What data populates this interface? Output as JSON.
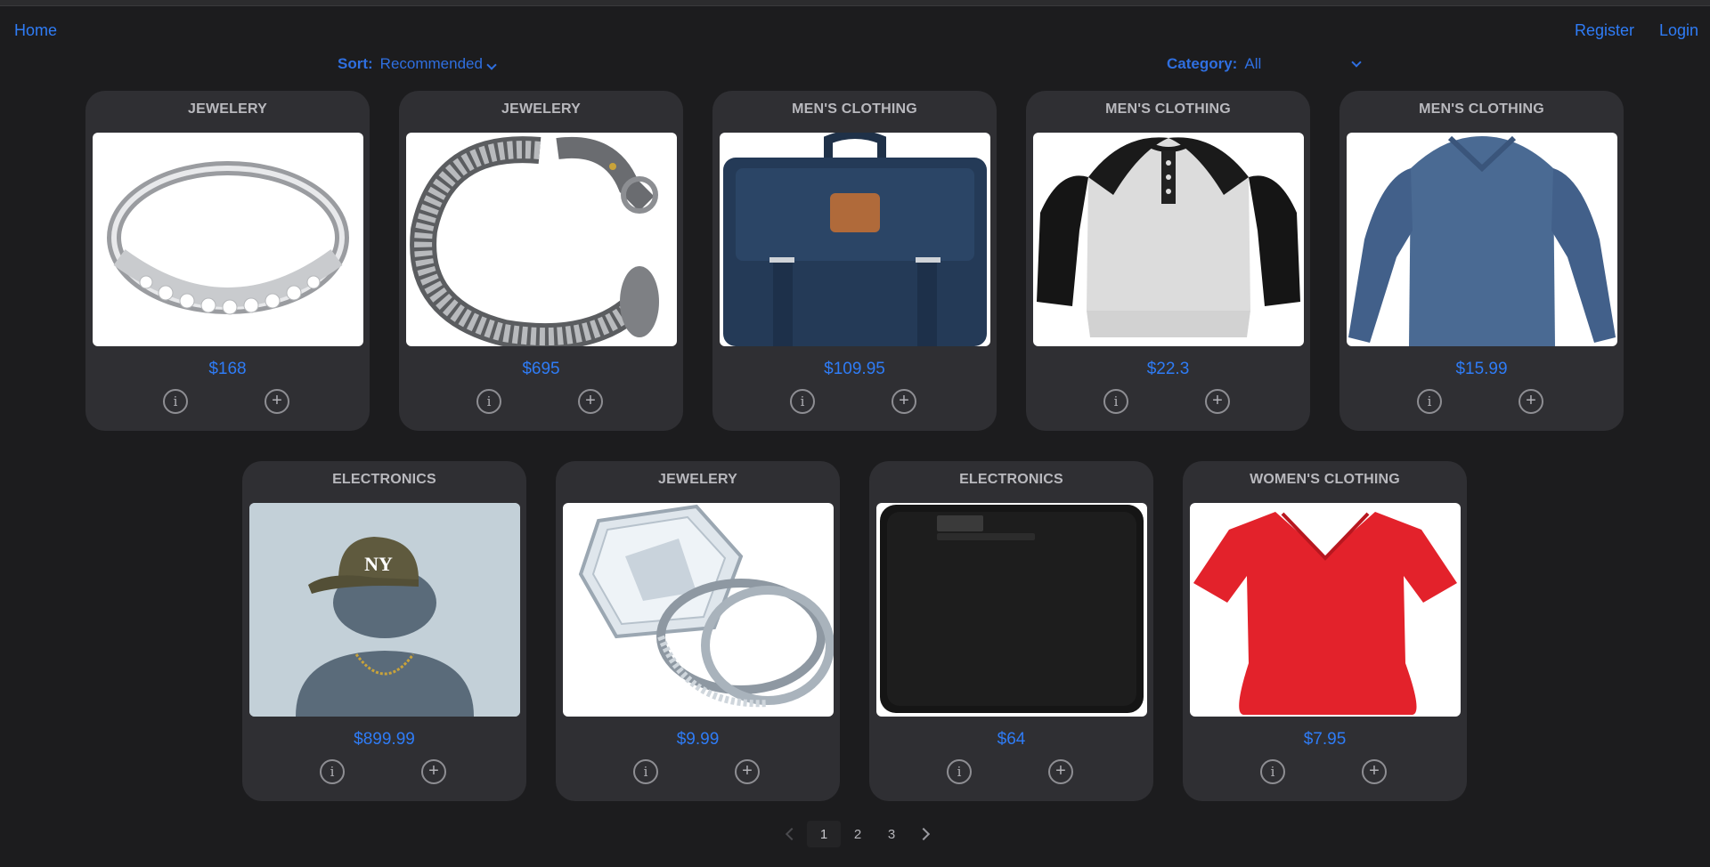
{
  "nav": {
    "home": "Home",
    "register": "Register",
    "login": "Login"
  },
  "filters": {
    "sort_label": "Sort:",
    "sort_value": "Recommended",
    "category_label": "Category:",
    "category_value": "All"
  },
  "products": [
    {
      "category": "JEWELERY",
      "price": "$168",
      "image": "silver-ring"
    },
    {
      "category": "JEWELERY",
      "price": "$695",
      "image": "dragon-bracelet"
    },
    {
      "category": "MEN'S CLOTHING",
      "price": "$109.95",
      "image": "navy-backpack"
    },
    {
      "category": "MEN'S CLOTHING",
      "price": "$22.3",
      "image": "raglan-henley-shirt"
    },
    {
      "category": "MEN'S CLOTHING",
      "price": "$15.99",
      "image": "blue-longsleeve-tee"
    },
    {
      "category": "ELECTRONICS",
      "price": "$899.99",
      "image": "cap-and-chain-avatar"
    },
    {
      "category": "JEWELERY",
      "price": "$9.99",
      "image": "diamond-ring-set"
    },
    {
      "category": "ELECTRONICS",
      "price": "$64",
      "image": "black-external-drive"
    },
    {
      "category": "WOMEN'S CLOTHING",
      "price": "$7.95",
      "image": "red-vneck-tee"
    }
  ],
  "pagination": {
    "pages": [
      "1",
      "2",
      "3"
    ],
    "current": "1"
  },
  "colors": {
    "background": "#1c1c1e",
    "card": "#2f2f33",
    "accent": "#2f7cf6"
  }
}
